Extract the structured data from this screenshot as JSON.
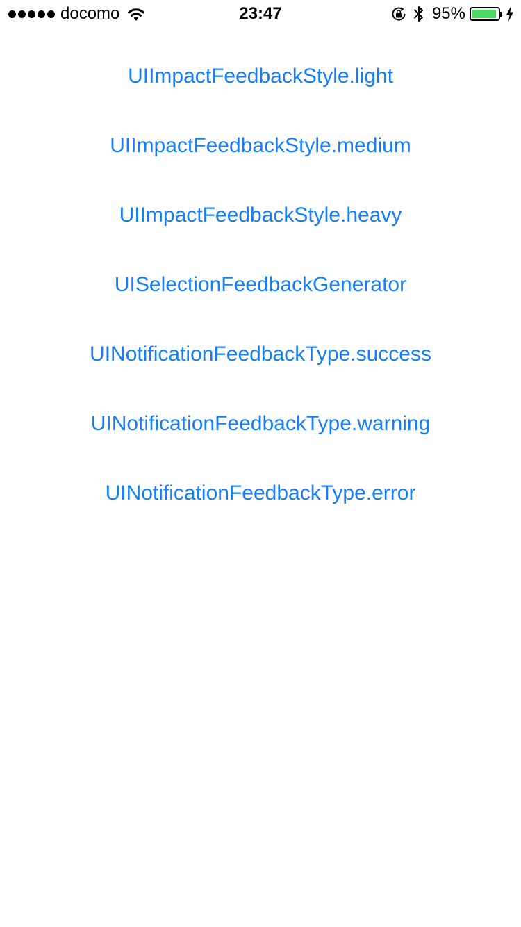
{
  "status_bar": {
    "signal_strength": 5,
    "carrier": "docomo",
    "time": "23:47",
    "battery_percent_text": "95%",
    "battery_level": 0.95,
    "battery_color": "#4cd964",
    "icons": [
      "signal-dots",
      "wifi-icon",
      "rotation-lock-icon",
      "bluetooth-icon",
      "battery-icon",
      "charging-bolt-icon"
    ]
  },
  "accent_color": "#157efb",
  "buttons": [
    {
      "label": "UIImpactFeedbackStyle.light"
    },
    {
      "label": "UIImpactFeedbackStyle.medium"
    },
    {
      "label": "UIImpactFeedbackStyle.heavy"
    },
    {
      "label": "UISelectionFeedbackGenerator"
    },
    {
      "label": "UINotificationFeedbackType.success"
    },
    {
      "label": "UINotificationFeedbackType.warning"
    },
    {
      "label": "UINotificationFeedbackType.error"
    }
  ]
}
